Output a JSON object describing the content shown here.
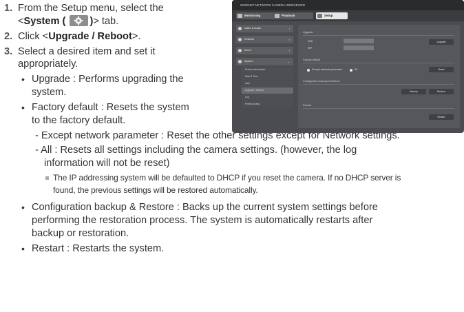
{
  "steps": [
    {
      "number": "1.",
      "line1": "From the Setup menu, select the",
      "pre": "<",
      "bold": "System (",
      "bold_close": ")",
      "post": "> tab."
    },
    {
      "number": "2.",
      "pre": "Click <",
      "bold": "Upgrade / Reboot",
      "post": ">."
    },
    {
      "number": "3.",
      "line1": "Select a desired item and set it",
      "line2": "appropriately."
    }
  ],
  "bullets": {
    "upgrade": {
      "line1": "Upgrade : Performs upgrading the",
      "line2": "system."
    },
    "factory": {
      "line1": "Factory default : Resets the system",
      "line2": "to the factory default."
    },
    "except": {
      "line1": "- Except network parameter : Reset the other settings except for Network settings."
    },
    "all": {
      "line1": "- All : Resets all settings including the camera settings. (however, the log",
      "line2": "information will not be reset)"
    },
    "note": {
      "line1": "The IP addressing system will be defaulted to DHCP if you reset the camera. If no DHCP server is",
      "line2": "found, the previous settings will be restored automatically."
    },
    "backup": {
      "line1": "Configuration backup & Restore : Backs up the current system settings before",
      "line2": "performing the restoration process. The system is automatically restarts after",
      "line3": "backup or restoration."
    },
    "restart": {
      "line1": "Restart : Restarts the system."
    }
  },
  "icons": {
    "system_tab_icon": "gear-icon",
    "bullet_glyph": "•",
    "note_marker": "square-icon"
  },
  "colors": {
    "text": "#333333",
    "icon_bg": "#8d8d8d",
    "screenshot_bg": "#4a4c4f"
  },
  "screenshot": {
    "brand": "WISENET NETWORK CAMERA WEBVIEWER",
    "tabs": [
      "Monitoring",
      "Playback",
      "Setup"
    ],
    "sidebar": [
      "Video & Audio",
      "Network",
      "Event",
      "System"
    ],
    "submenu": [
      "Product information",
      "Date & Time",
      "User",
      "Upgrade / Reboot",
      "Log",
      "Profile access"
    ],
    "sections": [
      "Upgrade",
      "Factory default",
      "Configuration backup & Restore",
      "Restart"
    ],
    "fields": {
      "s_w": "S/W",
      "s_w_value": "",
      "isp": "ISP",
      "isp_value": ""
    },
    "buttons": {
      "upgrade": "Upgrade",
      "reset": "Reset",
      "backup": "Backup",
      "restore": "Restore",
      "restart": "Restart"
    },
    "option": "Except network parameter",
    "option2": "All"
  }
}
